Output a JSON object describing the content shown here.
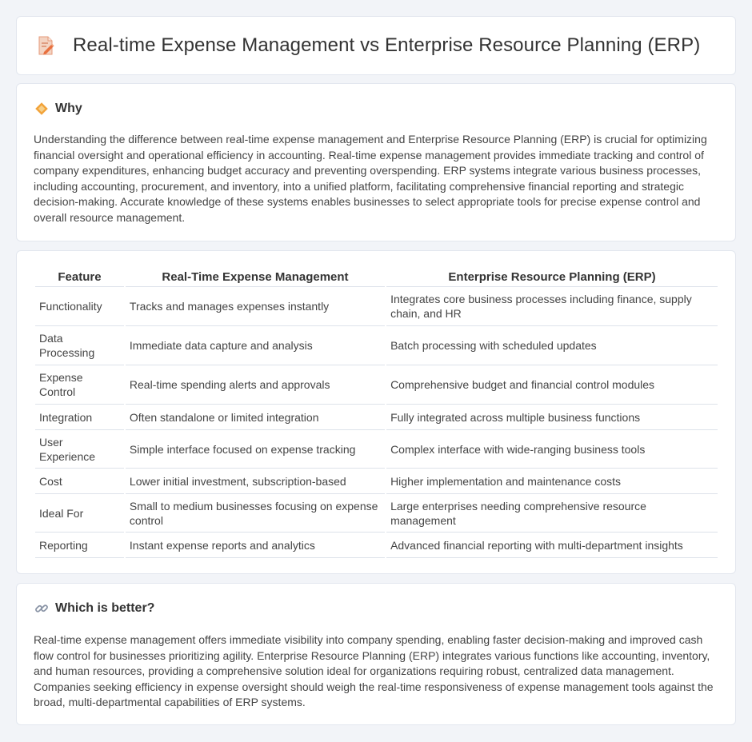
{
  "header": {
    "title": "Real-time Expense Management vs Enterprise Resource Planning (ERP)"
  },
  "why": {
    "heading": "Why",
    "text": "Understanding the difference between real-time expense management and Enterprise Resource Planning (ERP) is crucial for optimizing financial oversight and operational efficiency in accounting. Real-time expense management provides immediate tracking and control of company expenditures, enhancing budget accuracy and preventing overspending. ERP systems integrate various business processes, including accounting, procurement, and inventory, into a unified platform, facilitating comprehensive financial reporting and strategic decision-making. Accurate knowledge of these systems enables businesses to select appropriate tools for precise expense control and overall resource management."
  },
  "table": {
    "headers": [
      "Feature",
      "Real-Time Expense Management",
      "Enterprise Resource Planning (ERP)"
    ],
    "rows": [
      [
        "Functionality",
        "Tracks and manages expenses instantly",
        "Integrates core business processes including finance, supply chain, and HR"
      ],
      [
        "Data Processing",
        "Immediate data capture and analysis",
        "Batch processing with scheduled updates"
      ],
      [
        "Expense Control",
        "Real-time spending alerts and approvals",
        "Comprehensive budget and financial control modules"
      ],
      [
        "Integration",
        "Often standalone or limited integration",
        "Fully integrated across multiple business functions"
      ],
      [
        "User Experience",
        "Simple interface focused on expense tracking",
        "Complex interface with wide-ranging business tools"
      ],
      [
        "Cost",
        "Lower initial investment, subscription-based",
        "Higher implementation and maintenance costs"
      ],
      [
        "Ideal For",
        "Small to medium businesses focusing on expense control",
        "Large enterprises needing comprehensive resource management"
      ],
      [
        "Reporting",
        "Instant expense reports and analytics",
        "Advanced financial reporting with multi-department insights"
      ]
    ]
  },
  "better": {
    "heading": "Which is better?",
    "text": "Real-time expense management offers immediate visibility into company spending, enabling faster decision-making and improved cash flow control for businesses prioritizing agility. Enterprise Resource Planning (ERP) integrates various functions like accounting, inventory, and human resources, providing a comprehensive solution ideal for organizations requiring robust, centralized data management. Companies seeking efficiency in expense oversight should weigh the real-time responsiveness of expense management tools against the broad, multi-departmental capabilities of ERP systems."
  },
  "icons": {
    "title": "document-edit-icon",
    "why": "diamond-icon",
    "better": "link-icon"
  }
}
